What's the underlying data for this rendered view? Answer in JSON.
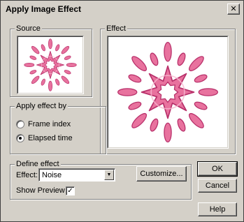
{
  "window": {
    "title": "Apply Image Effect",
    "close_icon": "close-icon",
    "close_glyph": "✕"
  },
  "source_group": {
    "label": "Source"
  },
  "effect_group": {
    "label": "Effect"
  },
  "apply_by": {
    "label": "Apply effect by",
    "options": [
      {
        "label": "Frame index",
        "checked": false
      },
      {
        "label": "Elapsed time",
        "checked": true
      }
    ]
  },
  "define_effect": {
    "label": "Define effect",
    "effect_label": "Effect:",
    "effect_value": "Noise",
    "customize_label": "Customize...",
    "show_preview_label": "Show Preview",
    "show_preview_checked": true,
    "check_glyph": "✓"
  },
  "buttons": {
    "ok": "OK",
    "cancel": "Cancel",
    "help": "Help"
  },
  "colors": {
    "burst_fill": "#e8729e",
    "burst_highlight": "#f7b8d0",
    "burst_outline": "#b8306a",
    "dialog_bg": "#d4d0c8"
  },
  "dropdown_arrow_glyph": "▼"
}
